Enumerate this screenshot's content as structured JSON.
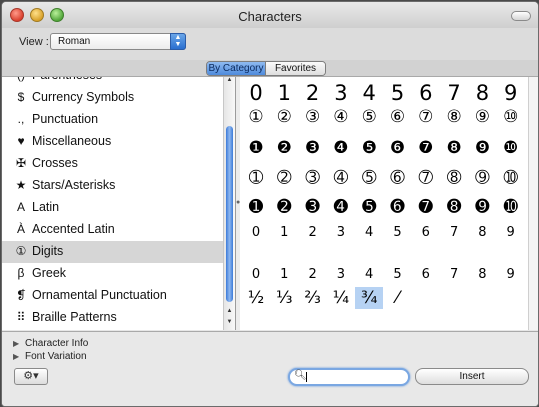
{
  "window": {
    "title": "Characters"
  },
  "toolbar": {
    "view_label": "View :",
    "view_value": "Roman"
  },
  "tabs": [
    {
      "label": "By Category",
      "active": true
    },
    {
      "label": "Favorites",
      "active": false
    }
  ],
  "sidebar": {
    "items": [
      {
        "icon": "()",
        "label": "Parentheses",
        "selected": false
      },
      {
        "icon": "$",
        "label": "Currency Symbols",
        "selected": false
      },
      {
        "icon": ".,",
        "label": "Punctuation",
        "selected": false
      },
      {
        "icon": "♥",
        "label": "Miscellaneous",
        "selected": false
      },
      {
        "icon": "✠",
        "label": "Crosses",
        "selected": false
      },
      {
        "icon": "★",
        "label": "Stars/Asterisks",
        "selected": false
      },
      {
        "icon": "A",
        "label": "Latin",
        "selected": false
      },
      {
        "icon": "À",
        "label": "Accented Latin",
        "selected": false
      },
      {
        "icon": "①",
        "label": "Digits",
        "selected": true
      },
      {
        "icon": "β",
        "label": "Greek",
        "selected": false
      },
      {
        "icon": "❡",
        "label": "Ornamental Punctuation",
        "selected": false
      },
      {
        "icon": "⠿",
        "label": "Braille Patterns",
        "selected": false
      }
    ]
  },
  "grid": {
    "rows": [
      {
        "size": "big",
        "chars": [
          "0",
          "1",
          "2",
          "3",
          "4",
          "5",
          "6",
          "7",
          "8",
          "9"
        ]
      },
      {
        "size": "med",
        "chars": [
          "①",
          "②",
          "③",
          "④",
          "⑤",
          "⑥",
          "⑦",
          "⑧",
          "⑨",
          "⑩"
        ]
      },
      {
        "size": "med",
        "chars": [
          "❶",
          "❷",
          "❸",
          "❹",
          "❺",
          "❻",
          "❼",
          "❽",
          "❾",
          "❿"
        ]
      },
      {
        "size": "med",
        "chars": [
          "➀",
          "➁",
          "➂",
          "➃",
          "➄",
          "➅",
          "➆",
          "➇",
          "➈",
          "➉"
        ]
      },
      {
        "size": "med",
        "chars": [
          "➊",
          "➋",
          "➌",
          "➍",
          "➎",
          "➏",
          "➐",
          "➑",
          "➒",
          "➓"
        ]
      },
      {
        "size": "small",
        "chars": [
          "0",
          "1",
          "2",
          "3",
          "4",
          "5",
          "6",
          "7",
          "8",
          "9"
        ]
      },
      {
        "size": "small",
        "chars": [
          "",
          "",
          "",
          "",
          "",
          "",
          "",
          "",
          "",
          ""
        ]
      },
      {
        "size": "small",
        "chars": [
          "0",
          "1",
          "2",
          "3",
          "4",
          "5",
          "6",
          "7",
          "8",
          "9"
        ]
      },
      {
        "size": "med",
        "chars": [
          "½",
          "⅓",
          "⅔",
          "¼",
          "¾",
          "⁄",
          "",
          "",
          "",
          ""
        ]
      }
    ],
    "selected": "¾"
  },
  "bottom": {
    "character_info": "Character Info",
    "font_variation": "Font Variation",
    "gear": "⚙▾",
    "search_value": "",
    "insert_label": "Insert"
  }
}
